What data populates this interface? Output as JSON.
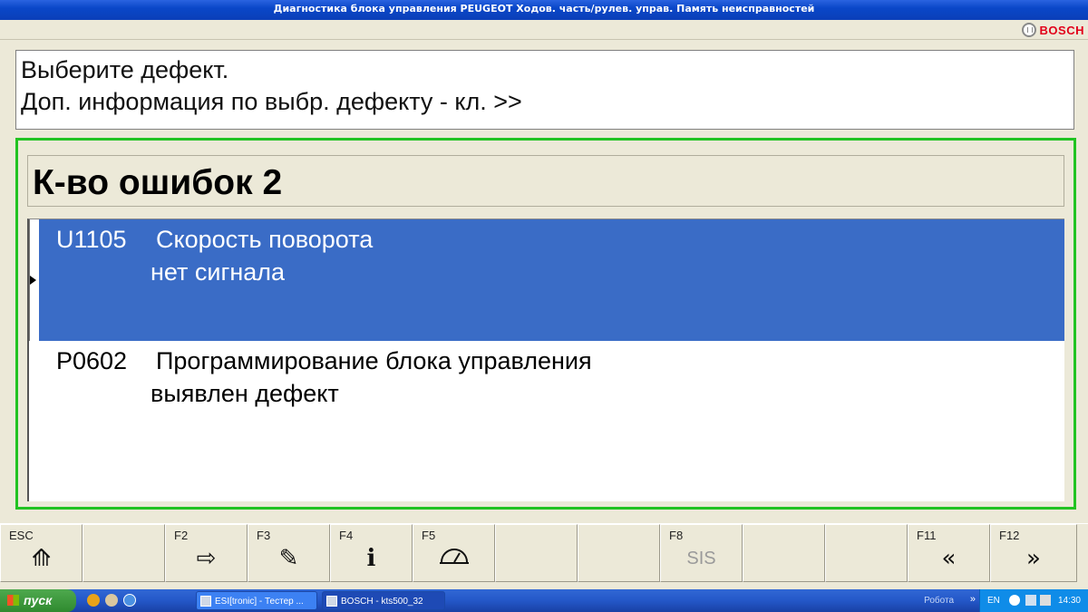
{
  "window": {
    "title": "Диагностика блока управления PEUGEOT Ходов. часть/рулев. управ. Память неисправностей",
    "brand": "BOSCH"
  },
  "info": {
    "line1": "Выберите дефект.",
    "line2": "Доп. информация по выбр. дефекту - кл. >>"
  },
  "faults": {
    "count_label": "К-во ошибок 2",
    "items": [
      {
        "code": "U1105",
        "description": "Скорость поворота",
        "status": "нет сигнала",
        "selected": true
      },
      {
        "code": "P0602",
        "description": "Программирование блока управления",
        "status": "выявлен дефект",
        "selected": false
      }
    ]
  },
  "function_keys": [
    {
      "key": "ESC",
      "icon": "double-chevron-up-icon",
      "glyph": "⟰"
    },
    {
      "key": "",
      "icon": "",
      "glyph": ""
    },
    {
      "key": "F2",
      "icon": "enter-arrow-icon",
      "glyph": "⇨"
    },
    {
      "key": "F3",
      "icon": "notepad-pen-icon",
      "glyph": "✎"
    },
    {
      "key": "F4",
      "icon": "info-icon",
      "glyph": "i"
    },
    {
      "key": "F5",
      "icon": "measurement-gauge-icon",
      "glyph": "◠"
    },
    {
      "key": "",
      "icon": "",
      "glyph": ""
    },
    {
      "key": "",
      "icon": "",
      "glyph": ""
    },
    {
      "key": "F8",
      "icon": "sis-label",
      "glyph": "SIS"
    },
    {
      "key": "",
      "icon": "",
      "glyph": ""
    },
    {
      "key": "",
      "icon": "",
      "glyph": ""
    },
    {
      "key": "F11",
      "icon": "double-chevron-left-icon",
      "glyph": "«"
    },
    {
      "key": "F12",
      "icon": "double-chevron-right-icon",
      "glyph": "»"
    }
  ],
  "taskbar": {
    "start_label": "пуск",
    "tasks": [
      {
        "label": "ESI[tronic] - Тестер ..."
      },
      {
        "label": "BOSCH - kts500_32"
      }
    ],
    "robota": "Робота",
    "language": "EN",
    "clock": "14:30"
  },
  "colors": {
    "selection": "#3a6cc6",
    "frame": "#22c322",
    "titlebar": "#0a47c8",
    "brand": "#e2001a"
  }
}
